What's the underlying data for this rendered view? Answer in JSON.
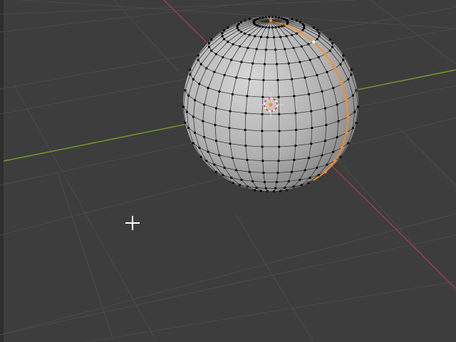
{
  "viewport": {
    "mode": "edit-mode",
    "colors": {
      "background": "#3d3d3d",
      "grid": "#4a4a4a",
      "x_axis": "#9b3b4a",
      "y_axis": "#6e9a2a",
      "selection": "#ff8c1a",
      "vertex": "#000000",
      "active_vertex": "#ffffff"
    }
  }
}
